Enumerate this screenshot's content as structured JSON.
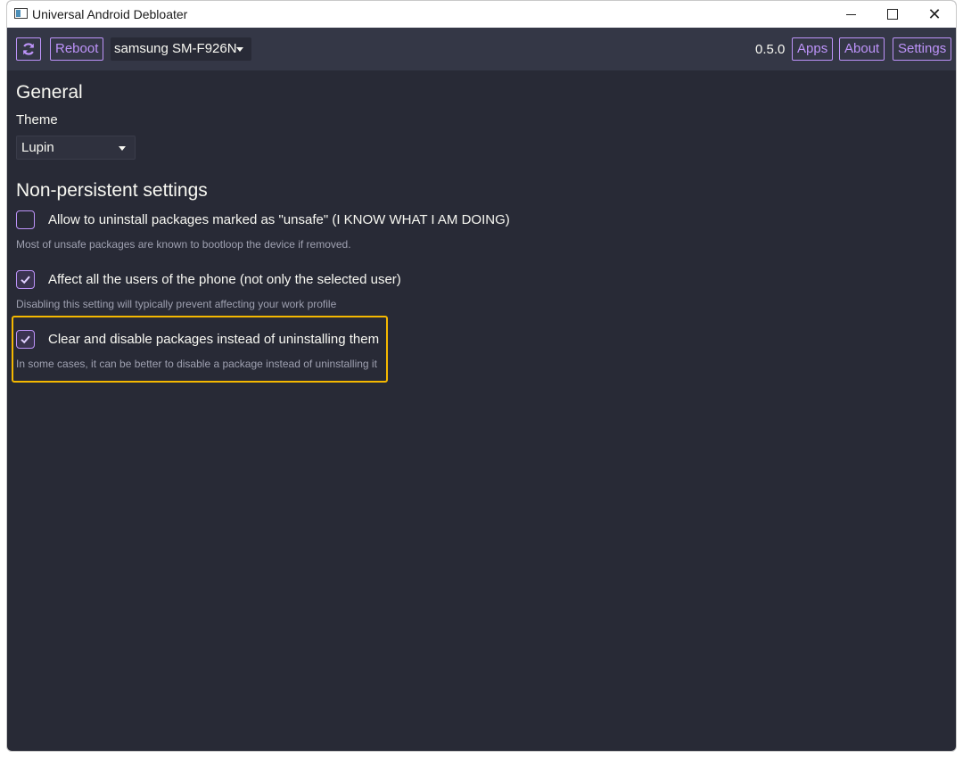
{
  "window": {
    "title": "Universal Android Debloater",
    "controls": {
      "minimize": "minimize-icon",
      "maximize": "maximize-icon",
      "close": "close-icon"
    }
  },
  "toolbar": {
    "refresh_icon": "refresh-icon",
    "reboot_label": "Reboot",
    "device": "samsung SM-F926N",
    "version": "0.5.0",
    "apps_label": "Apps",
    "about_label": "About",
    "settings_label": "Settings"
  },
  "general": {
    "title": "General",
    "theme_label": "Theme",
    "theme_value": "Lupin"
  },
  "nonpersistent": {
    "title": "Non-persistent settings",
    "settings": [
      {
        "label": "Allow to uninstall packages marked as \"unsafe\" (I KNOW WHAT I AM DOING)",
        "description": "Most of unsafe packages are known to bootloop the device if removed.",
        "checked": false
      },
      {
        "label": "Affect all the users of the phone (not only the selected user)",
        "description": "Disabling this setting will typically prevent affecting your work profile",
        "checked": true
      },
      {
        "label": "Clear and disable packages instead of uninstalling them",
        "description": "In some cases, it can be better to disable a package instead of uninstalling it",
        "checked": true
      }
    ]
  },
  "colors": {
    "accent": "#bd93f9",
    "background": "#282a36",
    "toolbar": "#343746",
    "highlight": "#f5b800"
  }
}
